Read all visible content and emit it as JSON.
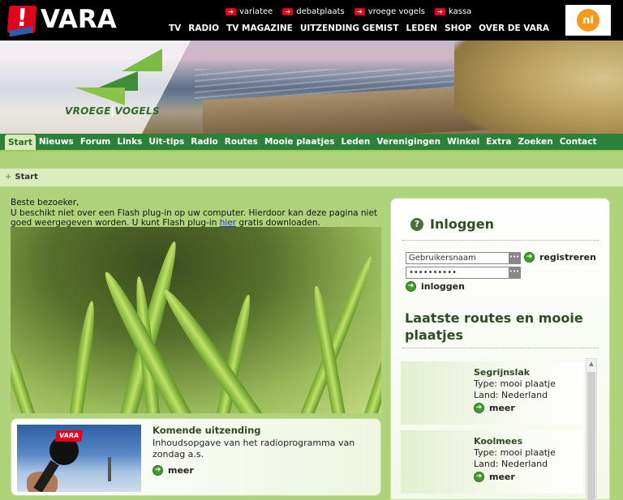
{
  "header": {
    "brand": "VARA",
    "quick_links": [
      "variatee",
      "debatplaats",
      "vroege vogels",
      "kassa"
    ],
    "main_nav": [
      "TV",
      "RADIO",
      "TV MAGAZINE",
      "UITZENDING GEMIST",
      "LEDEN",
      "SHOP",
      "OVER DE VARA"
    ],
    "nl_logo": "nl"
  },
  "banner": {
    "program_name_left": "VROEGE",
    "program_sep": "|",
    "program_name_right": "VOGELS"
  },
  "subnav": {
    "items": [
      "Start",
      "Nieuws",
      "Forum",
      "Links",
      "Uit-tips",
      "Radio",
      "Routes",
      "Mooie plaatjes",
      "Leden",
      "Verenigingen",
      "Winkel",
      "Extra",
      "Zoeken",
      "Contact"
    ],
    "active": "Start"
  },
  "breadcrumb": {
    "arrow": "+",
    "label": "Start"
  },
  "flash_notice": {
    "line1": "Beste bezoeker,",
    "line2": "U beschikt niet over een Flash plug-in op uw computer. Hierdoor kan deze pagina niet goed weergegeven worden. U kunt Flash plug-in ",
    "link": "hier",
    "line3": " gratis downloaden."
  },
  "feature": {
    "title": "Komende uitzending",
    "description": "Inhoudsopgave van het radioprogramma van zondag a.s.",
    "more": "meer",
    "mic_flag": "VARA"
  },
  "login": {
    "title": "Inloggen",
    "username_value": "Gebruikersnaam",
    "password_value": "••••••••••",
    "register": "registreren",
    "login": "inloggen"
  },
  "latest": {
    "title": "Laatste routes en mooie plaatjes",
    "items": [
      {
        "name": "Segrijnslak",
        "type": "Type: mooi plaatje",
        "land": "Land: Nederland",
        "more": "meer"
      },
      {
        "name": "Koolmees",
        "type": "Type: mooi plaatje",
        "land": "Land: Nederland",
        "more": "meer"
      }
    ]
  },
  "colors": {
    "vara_red": "#e2001a",
    "nav_green": "#2c8138",
    "band_green": "#aed37a"
  }
}
